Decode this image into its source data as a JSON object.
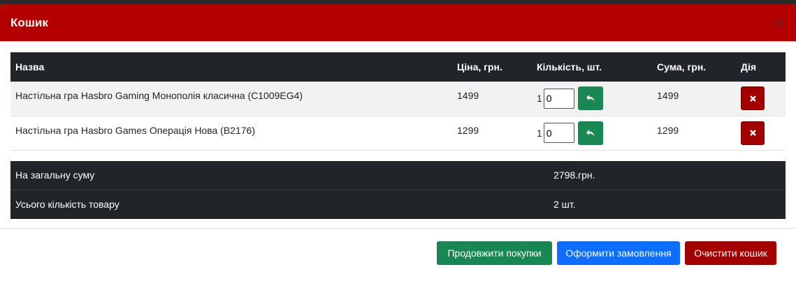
{
  "modal": {
    "title": "Кошик",
    "close_icon": "close-icon"
  },
  "table": {
    "headers": [
      "Назва",
      "Ціна, грн.",
      "Кількість, шт.",
      "Сума, грн.",
      "Дія"
    ],
    "rows": [
      {
        "name": "Настільна гра Hasbro Gaming Монополія класична (C1009EG4)",
        "price": "1499",
        "qty": "1",
        "qty_input": "0",
        "sum": "1499",
        "update_icon": "undo-arrow-icon",
        "remove_icon": "times-icon"
      },
      {
        "name": "Настільна гра Hasbro Games Операція Нова (B2176)",
        "price": "1299",
        "qty": "1",
        "qty_input": "0",
        "sum": "1299",
        "update_icon": "undo-arrow-icon",
        "remove_icon": "times-icon"
      }
    ]
  },
  "summary": {
    "total_label": "На загальну суму",
    "total_value": "2798.грн.",
    "count_label": "Усього кількість товару",
    "count_value": "2 шт."
  },
  "footer": {
    "continue_label": "Продовжити покупки",
    "order_label": "Оформити замовлення",
    "clear_label": "Очистити кошик"
  },
  "colors": {
    "header_bg": "#b30000",
    "table_header_bg": "#212529",
    "success": "#198754",
    "primary": "#0d6efd",
    "danger": "#a30000"
  }
}
